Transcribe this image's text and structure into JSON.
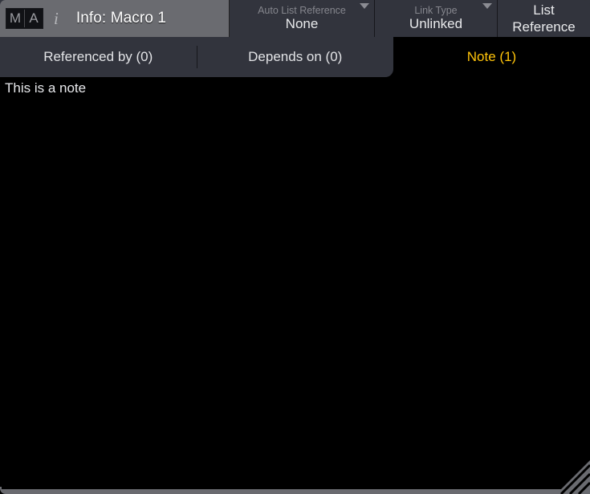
{
  "window": {
    "title": "Info: Macro 1",
    "logo_letters": [
      "M",
      "A"
    ],
    "info_icon_glyph": "i"
  },
  "header": {
    "fields": [
      {
        "name": "auto-list-reference",
        "label": "Auto List Reference",
        "value": "None",
        "has_dropdown": true
      },
      {
        "name": "link-type",
        "label": "Link Type",
        "value": "Unlinked",
        "has_dropdown": true
      }
    ],
    "list_reference_button": {
      "line1": "List",
      "line2": "Reference"
    }
  },
  "tabs": [
    {
      "name": "referenced-by",
      "label": "Referenced by (0)",
      "active": false
    },
    {
      "name": "depends-on",
      "label": "Depends on (0)",
      "active": false
    },
    {
      "name": "note",
      "label": "Note (1)",
      "active": true
    }
  ],
  "note": {
    "text": "This is a note"
  },
  "colors": {
    "accent_active_tab_text": "#ffc40a",
    "panel_background": "#32343d",
    "title_bar_background": "#6a6b70",
    "body_background": "#000000",
    "label_text": "#85868d",
    "value_text": "#e9eaec"
  }
}
